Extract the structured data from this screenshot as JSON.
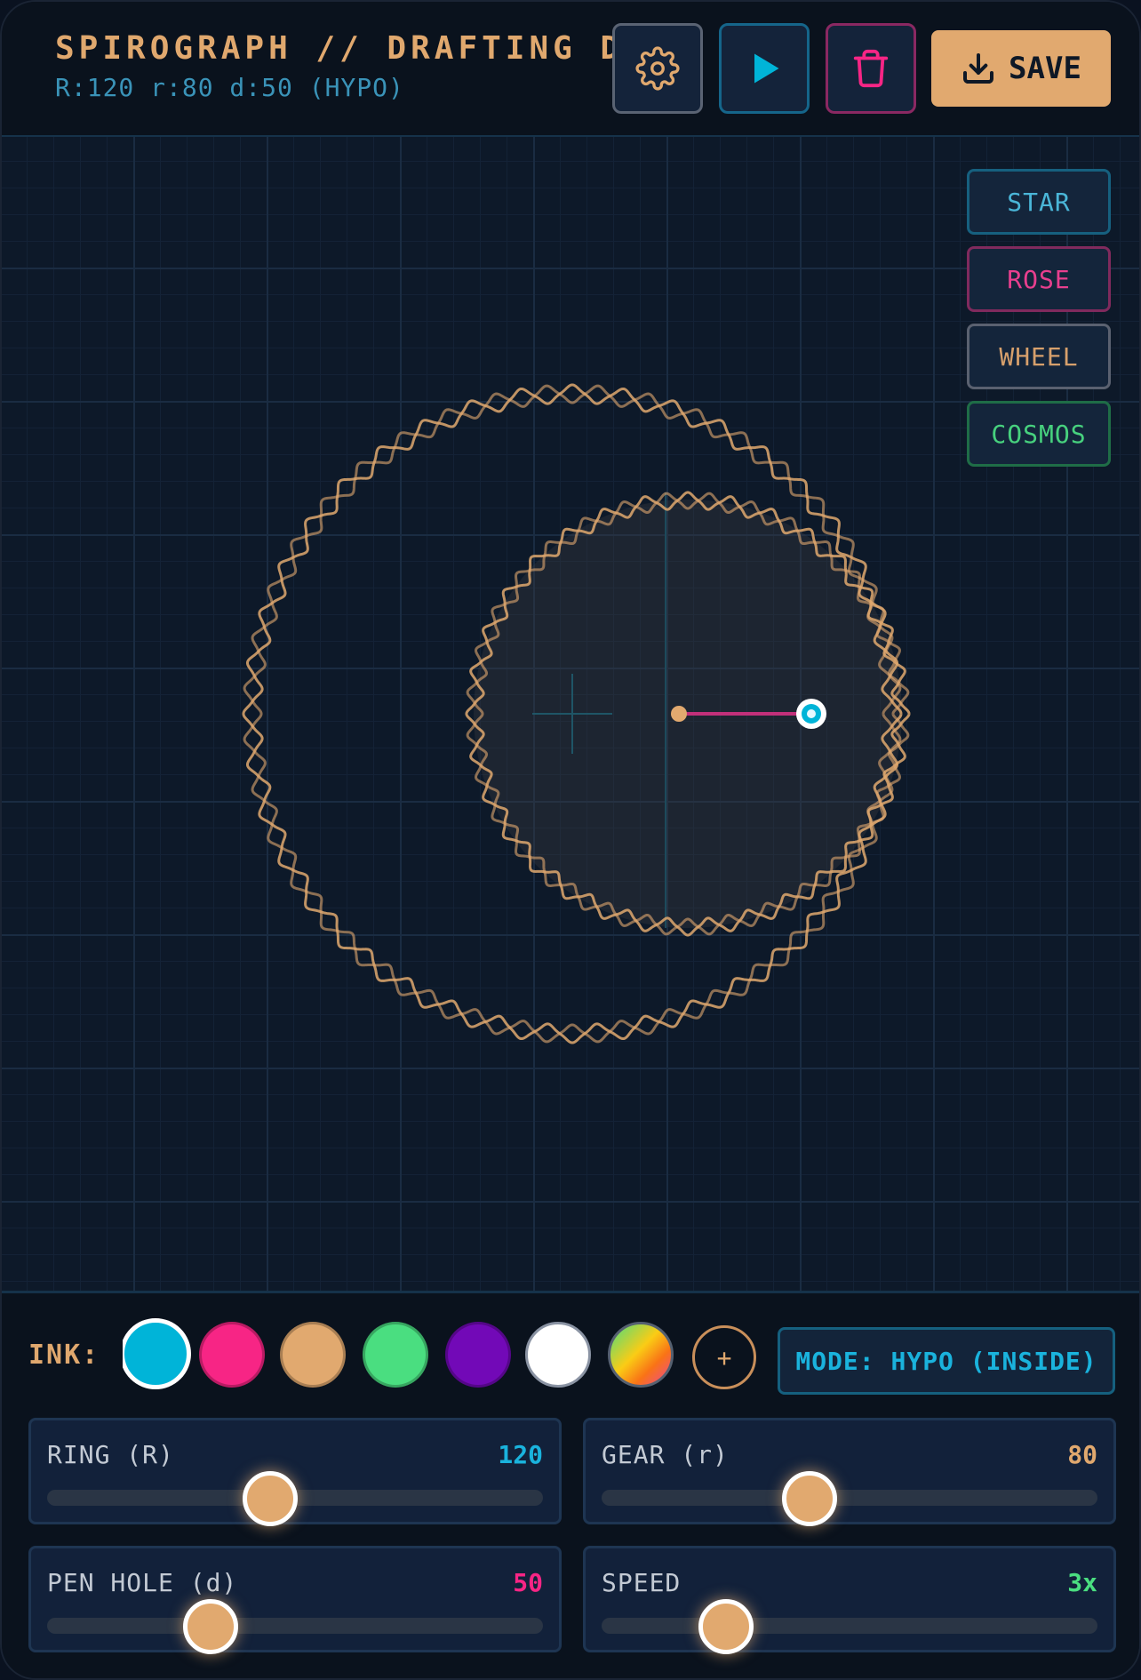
{
  "header": {
    "title": "SPIROGRAPH // DRAFTING DE",
    "subtitle": "R:120 r:80 d:50 (HYPO)",
    "save_label": "SAVE"
  },
  "presets": [
    "STAR",
    "ROSE",
    "WHEEL",
    "COSMOS"
  ],
  "ink": {
    "label": "INK:",
    "swatches": [
      "#00b4d8",
      "#f72585",
      "#e1a96f",
      "#4ade80",
      "#7209b7",
      "#ffffff",
      "rainbow-gradient"
    ],
    "selected_index": 0,
    "add_label": "+"
  },
  "mode_label": "MODE: HYPO (INSIDE)",
  "sliders": [
    {
      "label": "RING (R)",
      "value": "120",
      "color": "#1ab3dd",
      "fraction": 0.45
    },
    {
      "label": "GEAR (r)",
      "value": "80",
      "color": "#e0a86e",
      "fraction": 0.42
    },
    {
      "label": "PEN HOLE (d)",
      "value": "50",
      "color": "#f72585",
      "fraction": 0.33
    },
    {
      "label": "SPEED",
      "value": "3x",
      "color": "#4ade80",
      "fraction": 0.25
    }
  ],
  "colors": {
    "accent": "#e1a96f",
    "cyan": "#1ab3dd",
    "pink": "#f72585",
    "green": "#4ade80"
  }
}
